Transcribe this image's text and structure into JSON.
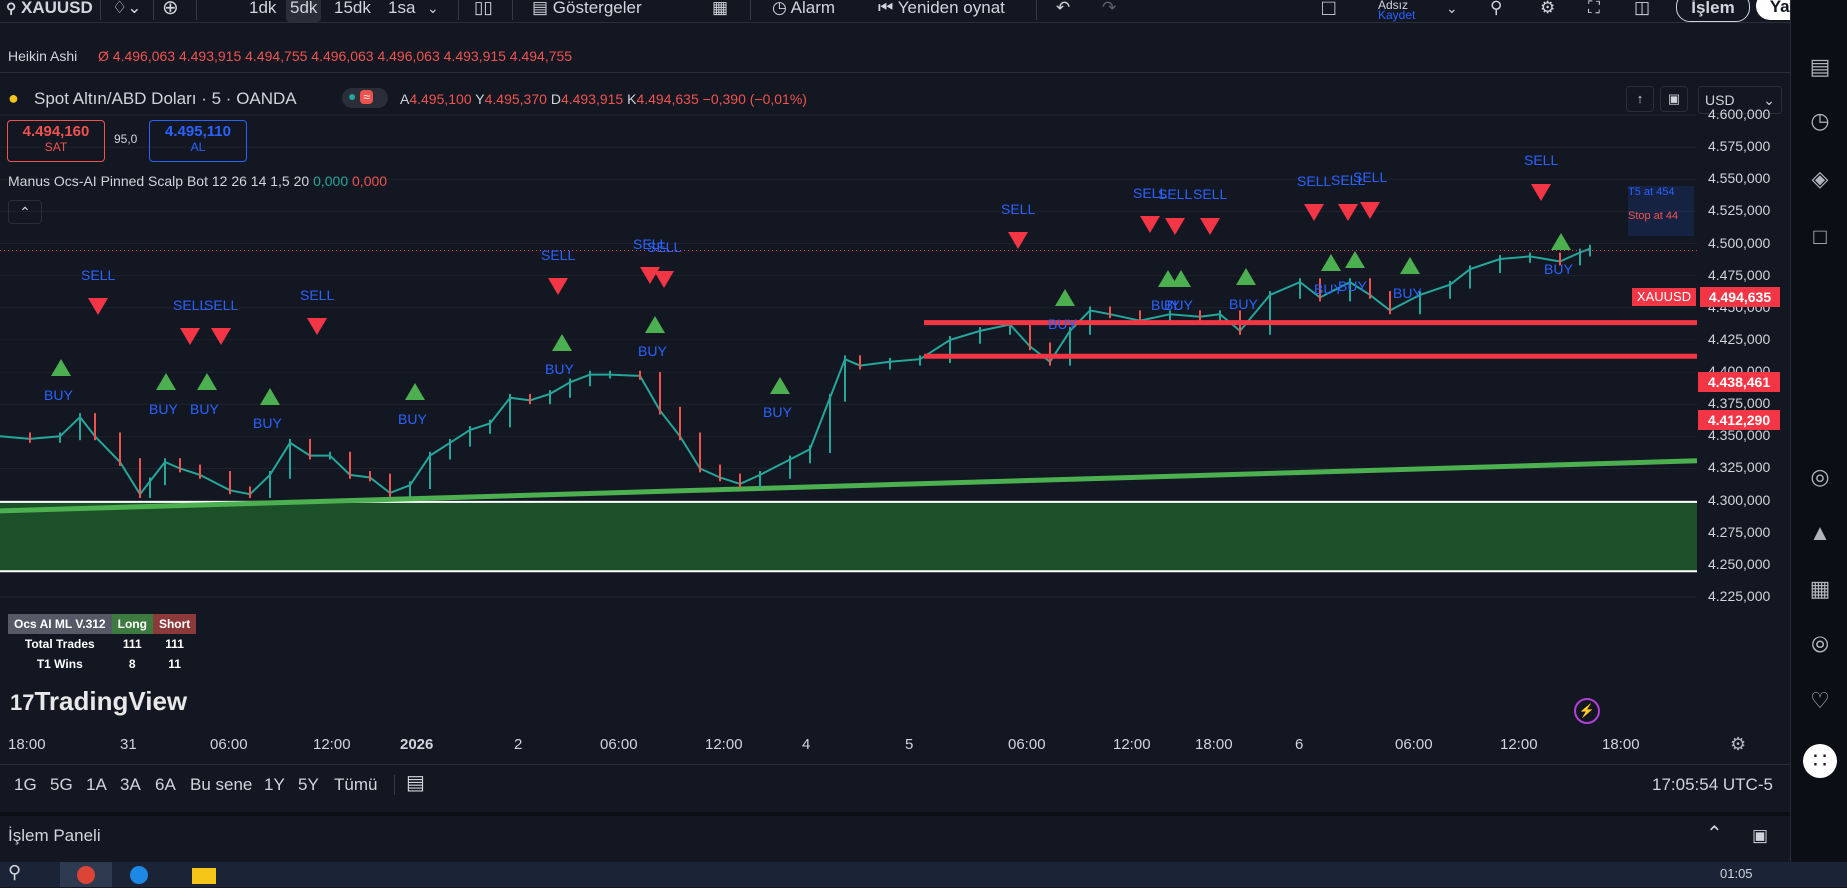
{
  "toolbar": {
    "symbol": "XAUUSD",
    "intervals": [
      "1dk",
      "5dk",
      "15dk",
      "1sa"
    ],
    "active_interval": "5dk",
    "indicators_label": "Göstergeler",
    "alarm_label": "Alarm",
    "replay_label": "Yeniden oynat",
    "layout_name": "Adsız",
    "save_label": "Kaydet",
    "trade_button": "İşlem",
    "publish_button": "Yayınla"
  },
  "legend": {
    "heikin_label": "Heikin Ashi",
    "heikin_values": "Ø 4.496,063 4.493,915 4.494,755 4.496,063 4.496,063 4.493,915 4.494,755",
    "title": "Spot Altın/ABD Doları · 5 · OANDA",
    "ohlc": {
      "o_label": "A",
      "o": "4.495,100",
      "h_label": "Y",
      "h": "4.495,370",
      "l_label": "D",
      "l": "4.493,915",
      "c_label": "K",
      "c": "4.494,635",
      "chg": "−0,390 (−0,01%)"
    },
    "sell_price": "4.494,160",
    "sell_label": "SAT",
    "spread": "95,0",
    "buy_price": "4.495,110",
    "buy_label": "AL",
    "indicator_name": "Manus Ocs-AI Pinned Scalp Bot 12 26 14 1,5 20",
    "indicator_v1": "0,000",
    "indicator_v2": "0,000",
    "currency": "USD"
  },
  "price_axis": [
    "4.600,000",
    "4.575,000",
    "4.550,000",
    "4.525,000",
    "4.500,000",
    "4.475,000",
    "4.450,000",
    "4.425,000",
    "4.400,000",
    "4.375,000",
    "4.350,000",
    "4.325,000",
    "4.300,000",
    "4.275,000",
    "4.250,000",
    "4.225,000"
  ],
  "price_tags": {
    "symbol_tag": "XAUUSD",
    "current": "4.494,635",
    "level1": "4.438,461",
    "level2": "4.412,290"
  },
  "time_axis": [
    "18:00",
    "31",
    "06:00",
    "12:00",
    "2026",
    "2",
    "06:00",
    "12:00",
    "4",
    "5",
    "06:00",
    "12:00",
    "18:00",
    "6",
    "06:00",
    "12:00",
    "18:00"
  ],
  "signals": {
    "sell_label": "SELL",
    "buy_label": "BUY"
  },
  "stats_table": {
    "headers": [
      "Ocs AI ML V.312",
      "Long",
      "Short"
    ],
    "rows": [
      [
        "Total Trades",
        "111",
        "111"
      ],
      [
        "T1 Wins",
        "8",
        "11"
      ]
    ]
  },
  "watermark": "TradingView",
  "corner_labels": {
    "tp_text": "T5 at 454",
    "stop_text": "Stop at 44"
  },
  "bottom_bar": {
    "ranges": [
      "1G",
      "5G",
      "1A",
      "3A",
      "6A",
      "Bu sene",
      "1Y",
      "5Y",
      "Tümü"
    ],
    "clock": "17:05:54 UTC-5"
  },
  "panel": {
    "title": "İşlem Paneli"
  },
  "taskbar": {
    "time": "01:05"
  },
  "colors": {
    "background": "#131722",
    "up": "#26a69a",
    "down": "#ef5350",
    "buy_marker": "#4caf50",
    "sell_marker": "#f23645",
    "level_line": "#f23645",
    "trend_line": "#4caf50",
    "zone": "#1e5a2a",
    "signal_text": "#2962ff"
  },
  "icons": [
    "search-icon",
    "plus-icon",
    "candles-icon",
    "indicators-icon",
    "layout-icon",
    "alarm-icon",
    "replay-icon",
    "undo-icon",
    "redo-icon",
    "fullscreen-icon",
    "camera-icon",
    "settings-icon",
    "watchlist-icon",
    "clock-icon",
    "layers-icon",
    "chat-icon",
    "target-icon",
    "bell-icon",
    "calendar-icon",
    "broadcast-icon",
    "apps-icon"
  ]
}
